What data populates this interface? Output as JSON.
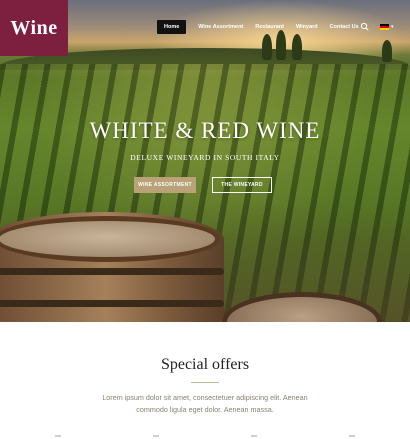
{
  "brand": {
    "logo_text": "Wine",
    "color": "#7d1f3f"
  },
  "nav": {
    "items": [
      {
        "label": "Home",
        "active": true
      },
      {
        "label": "Wine Assortment",
        "active": false
      },
      {
        "label": "Restaurant",
        "active": false
      },
      {
        "label": "Winyard",
        "active": false
      },
      {
        "label": "Contact Us",
        "active": false
      }
    ],
    "search_icon": "search-icon",
    "language_flag": "de-flag-icon"
  },
  "hero": {
    "title": "WHITE & RED WINE",
    "subtitle": "DELUXE WINEYARD IN SOUTH ITALY",
    "primary_button": "WINE ASSORTMENT",
    "secondary_button": "THE WINEYARD",
    "button_accent": "#b9a178"
  },
  "offers": {
    "title": "Special offers",
    "text": "Lorem ipsum dolor sit amet, consectetuer adipiscing elit. Aenean commodo ligula eget dolor. Aenean massa."
  }
}
